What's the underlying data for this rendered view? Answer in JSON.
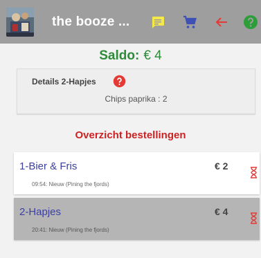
{
  "app": {
    "title": "the booze ..."
  },
  "toolbar": {
    "icons": [
      "message-icon",
      "shopping-cart-icon",
      "arrow-back-icon",
      "help-icon"
    ],
    "colors": {
      "message": "#f5e94a",
      "cart": "#3f51b5",
      "back": "#e53935",
      "help": "#2e9e3a"
    }
  },
  "saldo": {
    "label": "Saldo:",
    "amount": "€ 4"
  },
  "details": {
    "title": "Details 2-Hapjes",
    "item": "Chips paprika : 2"
  },
  "orders_title": "Overzicht bestellingen",
  "orders": [
    {
      "name": "1-Bier & Fris",
      "status": "09:54: Nieuw (Pining the fjords)",
      "amount": "€ 2",
      "selected": false
    },
    {
      "name": "2-Hapjes",
      "status": "20:41: Nieuw (Pining the fjords)",
      "amount": "€ 4",
      "selected": true
    }
  ],
  "colors": {
    "appbar": "#9e9e9e",
    "saldo": "#2e8b3a",
    "section_title": "#cc2222",
    "order_name": "#3a3fa0",
    "hourglass": "#e53935"
  }
}
